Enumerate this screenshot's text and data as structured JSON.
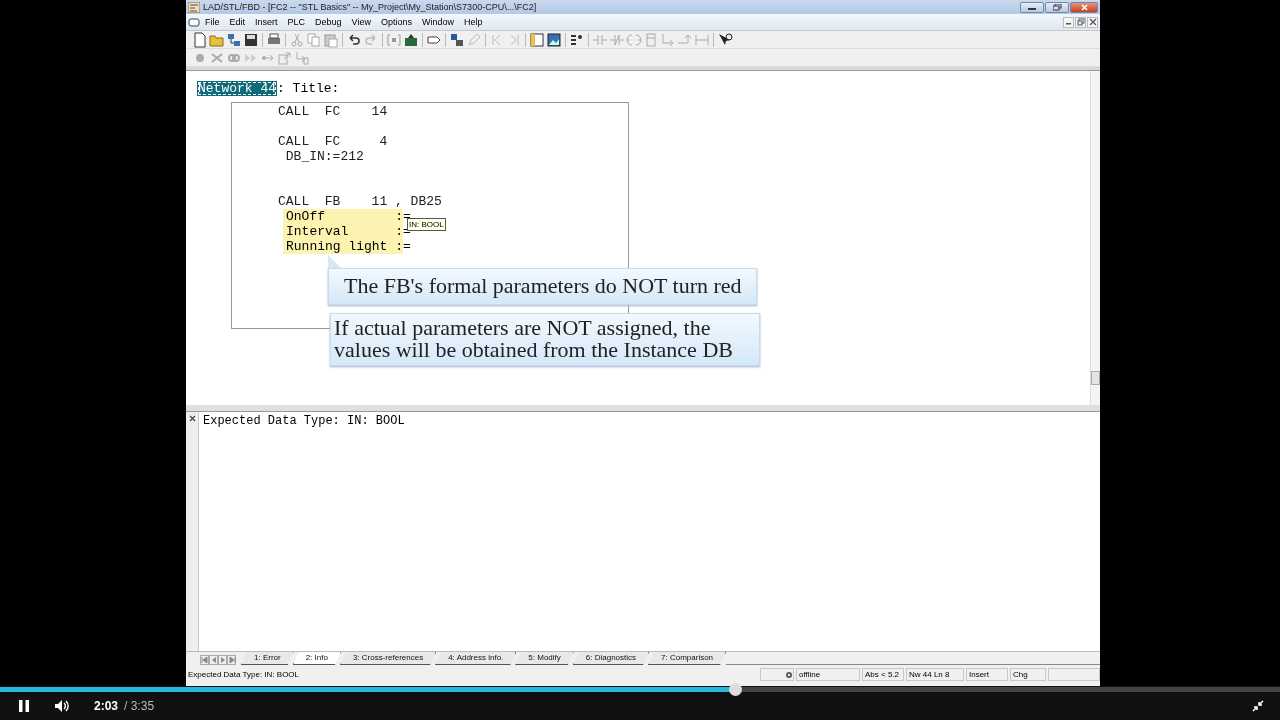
{
  "window": {
    "title": "LAD/STL/FBD  - [FC2 -- \"STL Basics\" -- My_Project\\My_Station\\S7300-CPU\\...\\FC2]"
  },
  "menu": [
    "File",
    "Edit",
    "Insert",
    "PLC",
    "Debug",
    "View",
    "Options",
    "Window",
    "Help"
  ],
  "editor": {
    "network": {
      "label": "Network 44",
      "selected": true
    },
    "title_label": ": Title:",
    "lines": [
      {
        "kind": "code",
        "text": "CALL  FC    14"
      },
      {
        "kind": "blank"
      },
      {
        "kind": "code",
        "text": "CALL  FC     4"
      },
      {
        "kind": "code",
        "text": " DB_IN:=212"
      },
      {
        "kind": "blank"
      },
      {
        "kind": "blank"
      },
      {
        "kind": "code",
        "text": "CALL  FB    11 , DB25"
      },
      {
        "kind": "param",
        "name": "OnOff",
        "colon": ":",
        "equals": "=",
        "highlighted": true
      },
      {
        "kind": "param",
        "name": "Interval",
        "colon": ":",
        "equals": "=",
        "highlighted": true
      },
      {
        "kind": "param",
        "name": "Running light",
        "colon": ":",
        "equals": "=",
        "highlighted": true
      }
    ],
    "tooltip": "IN: BOOL",
    "callouts": [
      {
        "text": "The FB's formal parameters do NOT turn red",
        "pointer": true
      },
      {
        "text": "If actual parameters are NOT assigned, the\nvalues will be obtained from the Instance DB",
        "pointer": false
      }
    ]
  },
  "info": {
    "message": "Expected Data Type: IN: BOOL",
    "tabs": [
      {
        "label": "1: Error",
        "selected": false
      },
      {
        "label": "2: Info",
        "selected": true
      },
      {
        "label": "3: Cross-references",
        "selected": false
      },
      {
        "label": "4: Address info.",
        "selected": false
      },
      {
        "label": "5: Modify",
        "selected": false
      },
      {
        "label": "6: Diagnostics",
        "selected": false
      },
      {
        "label": "7: Comparison",
        "selected": false
      }
    ]
  },
  "status_bar": {
    "message": "Expected Data Type: IN: BOOL",
    "fields": [
      "offline",
      "Abs < 5.2",
      "Nw 44  Ln 8",
      "Insert",
      "Chg"
    ]
  },
  "player": {
    "playing": true,
    "progress": {
      "level": 0.574
    },
    "time": "2:03",
    "duration": "/ 3:35"
  }
}
